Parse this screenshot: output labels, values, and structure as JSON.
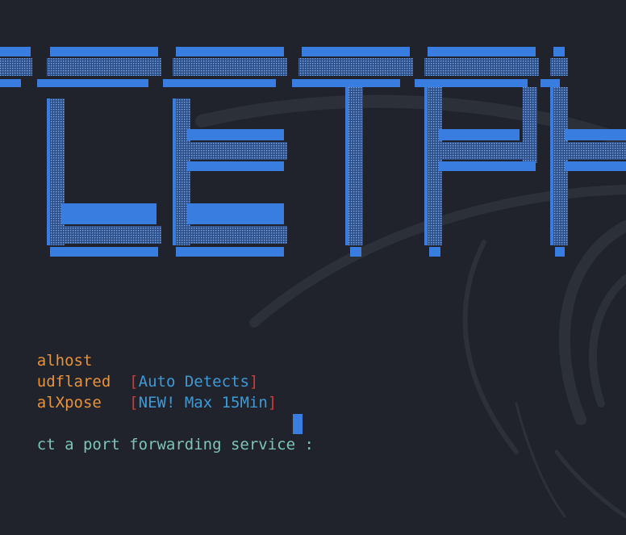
{
  "banner": {
    "text": "TCETPH",
    "color": "#3a7de0"
  },
  "menu": {
    "options": [
      {
        "label": "alhost",
        "note": ""
      },
      {
        "label": "udflared",
        "note": "Auto Detects"
      },
      {
        "label": "alXpose",
        "note": "NEW! Max 15Min"
      }
    ],
    "bracket_open": "[",
    "bracket_close": "]",
    "option_color": "#e8923a",
    "note_color": "#3e9ad6",
    "bracket_color": "#d23a3a"
  },
  "prompt": {
    "text": "ct a port forwarding service : ",
    "color": "#7ec4ba"
  },
  "background": {
    "color": "#20232b",
    "watermark": "dragon-logo-watermark"
  }
}
